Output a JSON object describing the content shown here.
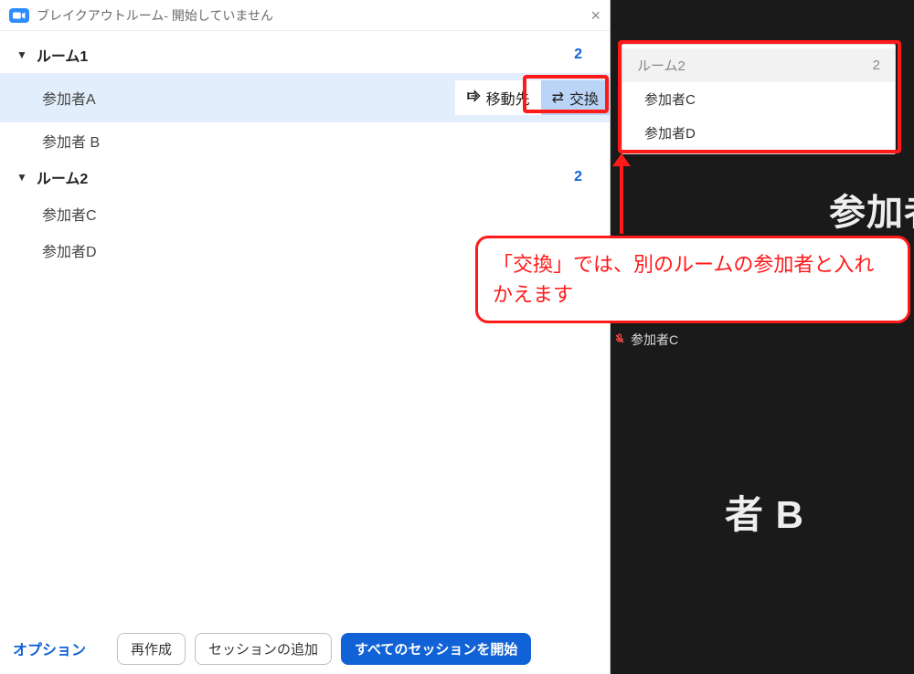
{
  "window": {
    "title": "ブレイクアウトルーム- 開始していません"
  },
  "rooms": [
    {
      "name": "ルーム1",
      "count": "2",
      "participants": [
        {
          "name": "参加者A",
          "selected": true
        },
        {
          "name": "参加者 B",
          "selected": false
        }
      ]
    },
    {
      "name": "ルーム2",
      "count": "2",
      "participants": [
        {
          "name": "参加者C",
          "selected": false
        },
        {
          "name": "参加者D",
          "selected": false
        }
      ]
    }
  ],
  "row_actions": {
    "move": "移動先",
    "exchange": "交換"
  },
  "footer": {
    "options": "オプション",
    "recreate": "再作成",
    "add_session": "セッションの追加",
    "start_all": "すべてのセッションを開始"
  },
  "exchange_popup": {
    "room": "ルーム2",
    "count": "2",
    "items": [
      "参加者C",
      "参加者D"
    ]
  },
  "gallery": {
    "tile_a": "参加者",
    "tile_b": "者 B",
    "label_c": "参加者C"
  },
  "annotation": {
    "text": "「交換」では、別のルームの参加者と入れかえます"
  }
}
